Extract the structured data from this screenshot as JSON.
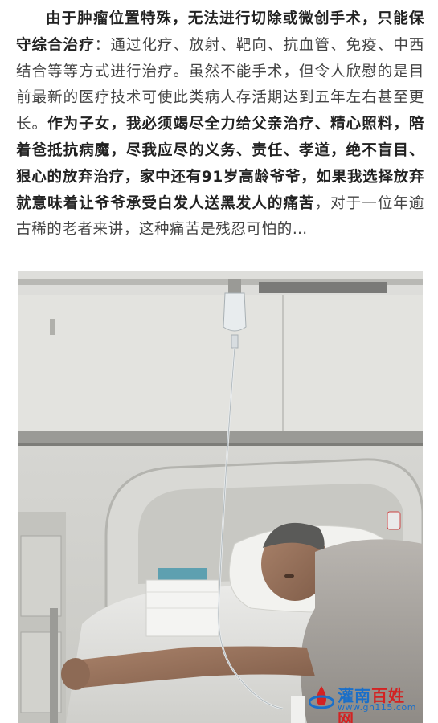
{
  "article": {
    "seg1": "由于肿瘤位置特殊，无法进行切除或微创手术，只能保守综合治疗",
    "seg2": "：通过化疗、放射、靶向、抗血管、免疫、中西结合等等方式进行治疗。虽然不能手术，但令人欣慰的是目前最新的医疗技术可使此类病人存活期达到五年左右甚至更长。",
    "seg3": "作为子女，我必须竭尽全力给父亲治疗、精心照料，陪着爸抵抗病魔，尽我应尽的义务、责任、孝道，绝不盲目、狠心的放弃治疗，家中还有91岁高龄爷爷，如果我选择放弃就意味着让爷爷承受白发人送黑发人的痛苦",
    "seg4": "，对于一位年逾古稀的老者来讲，这种痛苦是残忍可怕的…"
  },
  "watermark": {
    "name_part1": "灌南",
    "name_part2": "百姓网",
    "url": "www.gn115.com"
  },
  "colors": {
    "bold_text": "#222222",
    "plain_text": "#444444",
    "watermark_blue": "#1a6fc9",
    "watermark_red": "#d32222"
  }
}
